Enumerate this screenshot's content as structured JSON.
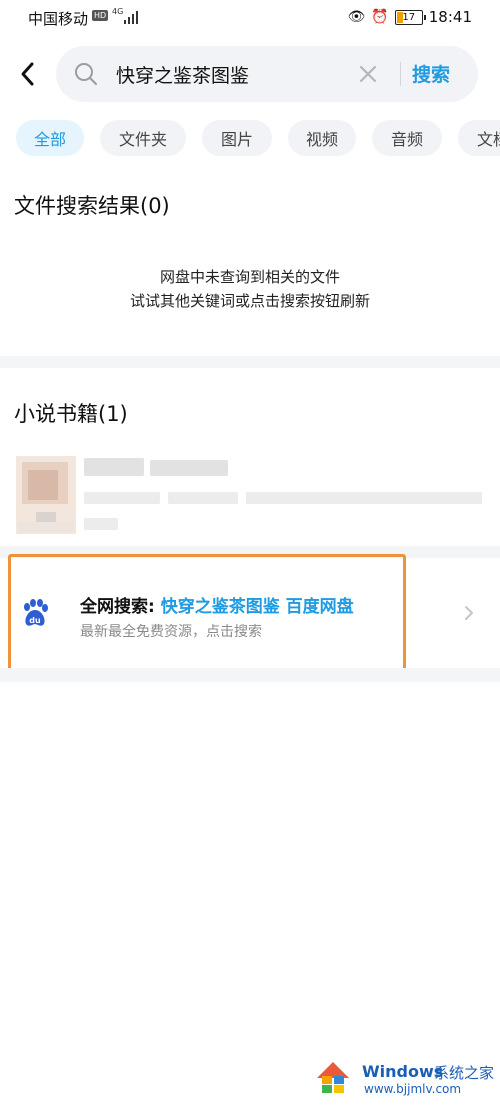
{
  "status_bar": {
    "carrier": "中国移动",
    "hd": "HD",
    "network": "4G",
    "battery": "17",
    "time": "18:41"
  },
  "search": {
    "query": "快穿之鉴茶图鉴",
    "button_label": "搜索"
  },
  "tabs": [
    "全部",
    "文件夹",
    "图片",
    "视频",
    "音频",
    "文档"
  ],
  "file_results": {
    "title": "文件搜索结果(0)",
    "empty_line1": "网盘中未查询到相关的文件",
    "empty_line2": "试试其他关键词或点击搜索按钮刷新"
  },
  "novel_results": {
    "title": "小说书籍(1)"
  },
  "web_search": {
    "prefix": "全网搜索:",
    "keyword": "快穿之鉴茶图鉴 百度网盘",
    "subtitle": "最新最全免费资源，点击搜索"
  },
  "watermark": {
    "brand": "Windows",
    "suffix": "系统之家",
    "url": "www.bjjmlv.com"
  },
  "colors": {
    "accent": "#1e9be2",
    "highlight_border": "#f0923a"
  }
}
